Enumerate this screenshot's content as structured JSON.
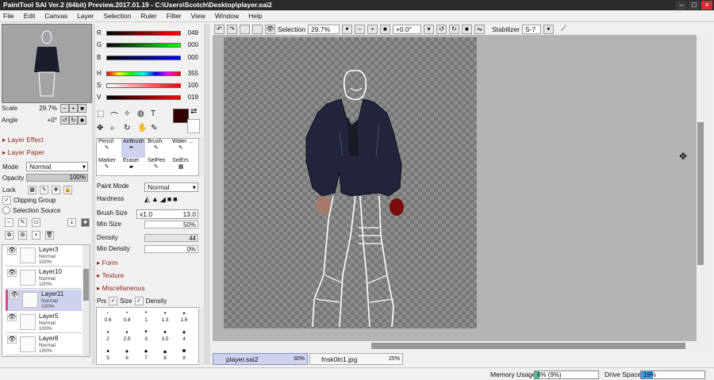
{
  "app": {
    "title": "PaintTool SAI Ver.2 (64bit) Preview.2017.01.19 - C:\\Users\\Scotch\\Desktop\\player.sai2"
  },
  "menu": [
    "File",
    "Edit",
    "Canvas",
    "Layer",
    "Selection",
    "Ruler",
    "Filter",
    "View",
    "Window",
    "Help"
  ],
  "navigator": {
    "scale_label": "Scale",
    "scale_value": "29.7%",
    "angle_label": "Angle",
    "angle_value": "+0°"
  },
  "left": {
    "layer_effect": "Layer Effect",
    "layer_paper": "Layer Paper",
    "mode_label": "Mode",
    "mode_value": "Normal",
    "opacity_label": "Opacity",
    "opacity_value": "100%",
    "lock_label": "Lock",
    "clipping_label": "Clipping Group",
    "selsrc_label": "Selection Source"
  },
  "layers": [
    {
      "name": "Layer3",
      "mode": "Normal",
      "opacity": "100%"
    },
    {
      "name": "Layer10",
      "mode": "Normal",
      "opacity": "100%"
    },
    {
      "name": "Layer11",
      "mode": "Normal",
      "opacity": "100%"
    },
    {
      "name": "Layer5",
      "mode": "Normal",
      "opacity": "100%"
    },
    {
      "name": "Layer8",
      "mode": "Normal",
      "opacity": "100%"
    }
  ],
  "color": {
    "r": "049",
    "g": "000",
    "b": "000",
    "h": "355",
    "s": "100",
    "v": "019",
    "labels": [
      "R",
      "G",
      "B",
      "H",
      "S",
      "V"
    ],
    "swatch": "#310000"
  },
  "tools": [
    "Pencil",
    "AirBrush",
    "Brush",
    "Water ...",
    "Marker",
    "Eraser",
    "SelPen",
    "SelErs"
  ],
  "brush": {
    "paint_mode_label": "Paint Mode",
    "paint_mode_value": "Normal",
    "hardness_label": "Hardness",
    "size_label": "Brush Size",
    "size_mult": "x1.0",
    "size_value": "13.0",
    "minsize_label": "Min Size",
    "minsize_value": "50%",
    "density_label": "Density",
    "density_value": "44",
    "mindensity_label": "Min Density",
    "mindensity_value": "0%",
    "form": "Form",
    "texture": "Texture",
    "misc": "Miscellaneous",
    "prs_label": "Prs",
    "prs_size": "Size",
    "prs_density": "Density"
  },
  "brush_sizes": [
    [
      "0.6",
      "0.8",
      "1",
      "1.3",
      "1.6"
    ],
    [
      "2",
      "2.5",
      "3",
      "3.5",
      "4"
    ],
    [
      "5",
      "6",
      "7",
      "8",
      "9"
    ]
  ],
  "toolbar": {
    "selection": "Selection",
    "zoom": "29.7%",
    "angle": "+0.0°",
    "stabilizer_label": "Stabilizer",
    "stabilizer_value": "S-7"
  },
  "tabs": [
    {
      "name": "player.sai2",
      "pct": "30%"
    },
    {
      "name": "fnsk0ln1.jpg",
      "pct": "25%"
    }
  ],
  "status": {
    "memory_label": "Memory Usage",
    "memory_value": "8% (9%)",
    "memory_level": 0.08,
    "drive_label": "Drive Space",
    "drive_value": "19%",
    "drive_level": 0.19
  }
}
